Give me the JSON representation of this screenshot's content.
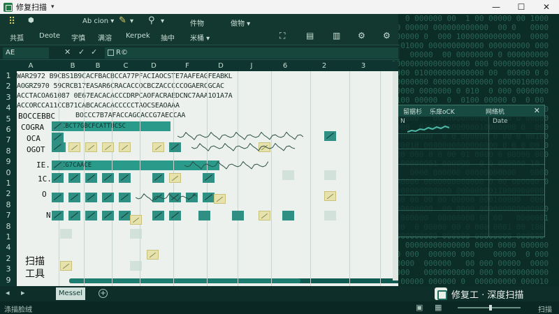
{
  "window": {
    "title": "修复扫描",
    "title_caret": "▾",
    "controls": {
      "minimize": "—",
      "maximize": "☐",
      "close": "✕"
    }
  },
  "ribbon": {
    "top_items": [
      "Ab cion ▾",
      "▾",
      "▾",
      "件物",
      "做物 ▾"
    ],
    "bottom_items": [
      "共孤",
      "Deote",
      "字慎",
      "满溶",
      "Kerpek",
      "抽中",
      "米桶 ▾"
    ]
  },
  "formula_bar": {
    "name_box": "AE",
    "fx_icons": [
      "✕",
      "✓",
      "✓"
    ],
    "content": "R©"
  },
  "columns": [
    "A",
    "B",
    "B",
    "C",
    "D",
    "F",
    "D",
    "J",
    "6",
    "2",
    "3"
  ],
  "rows": [
    "1",
    "2",
    "3",
    "4",
    "5",
    "6",
    "7",
    "8",
    "9",
    "0",
    "1",
    "2",
    "8",
    "7",
    "8",
    "1",
    "4",
    "2",
    "3",
    "9"
  ],
  "row_labels": [
    "BOCCEBBC",
    "COGRA",
    "OCA",
    "OGOT",
    "IE.",
    "1C.",
    "O",
    "N"
  ],
  "text_lines": [
    "WAR2972 B9CBS1B9CACFBACBCCA77PFACIAOCSTE7AAFEAGFEABKL",
    "AOGRZ970 59CRCB17EASAR6CRACACCOCBCZACCCCCOGAERCGCAC",
    "ACCTACOA61087 0E67EACACACCCDRPCAOFACRAEDCNC7AAA1O1A7A",
    "ACCORCCA11CCB71CABCACACACCCCCTAOCSEAOAAA"
  ],
  "highlight_texts": [
    "BOCCC7B7AFACCAGCACCG7AECCAA",
    "AGCBCT7GBCFCATTBCSC",
    "DCCG7CAACE"
  ],
  "scan_tool_label": [
    "扫描",
    "工具"
  ],
  "progress": {
    "value": 0.69
  },
  "sheet_tabs": {
    "active": "Messel",
    "add": "+"
  },
  "status": {
    "left": "涤描脸绒",
    "right": "扫描"
  },
  "panel": {
    "tabs": [
      "留据杉",
      "乐扉oCK",
      "网络杭"
    ],
    "close": "✕",
    "cell_text": [
      "N",
      "Date"
    ]
  },
  "watermark": {
    "text": "修复工 · 深度扫描"
  },
  "colors": {
    "accent": "#2a9a8a",
    "bg": "#0c2c26",
    "sheet": "#ecf1ed"
  }
}
